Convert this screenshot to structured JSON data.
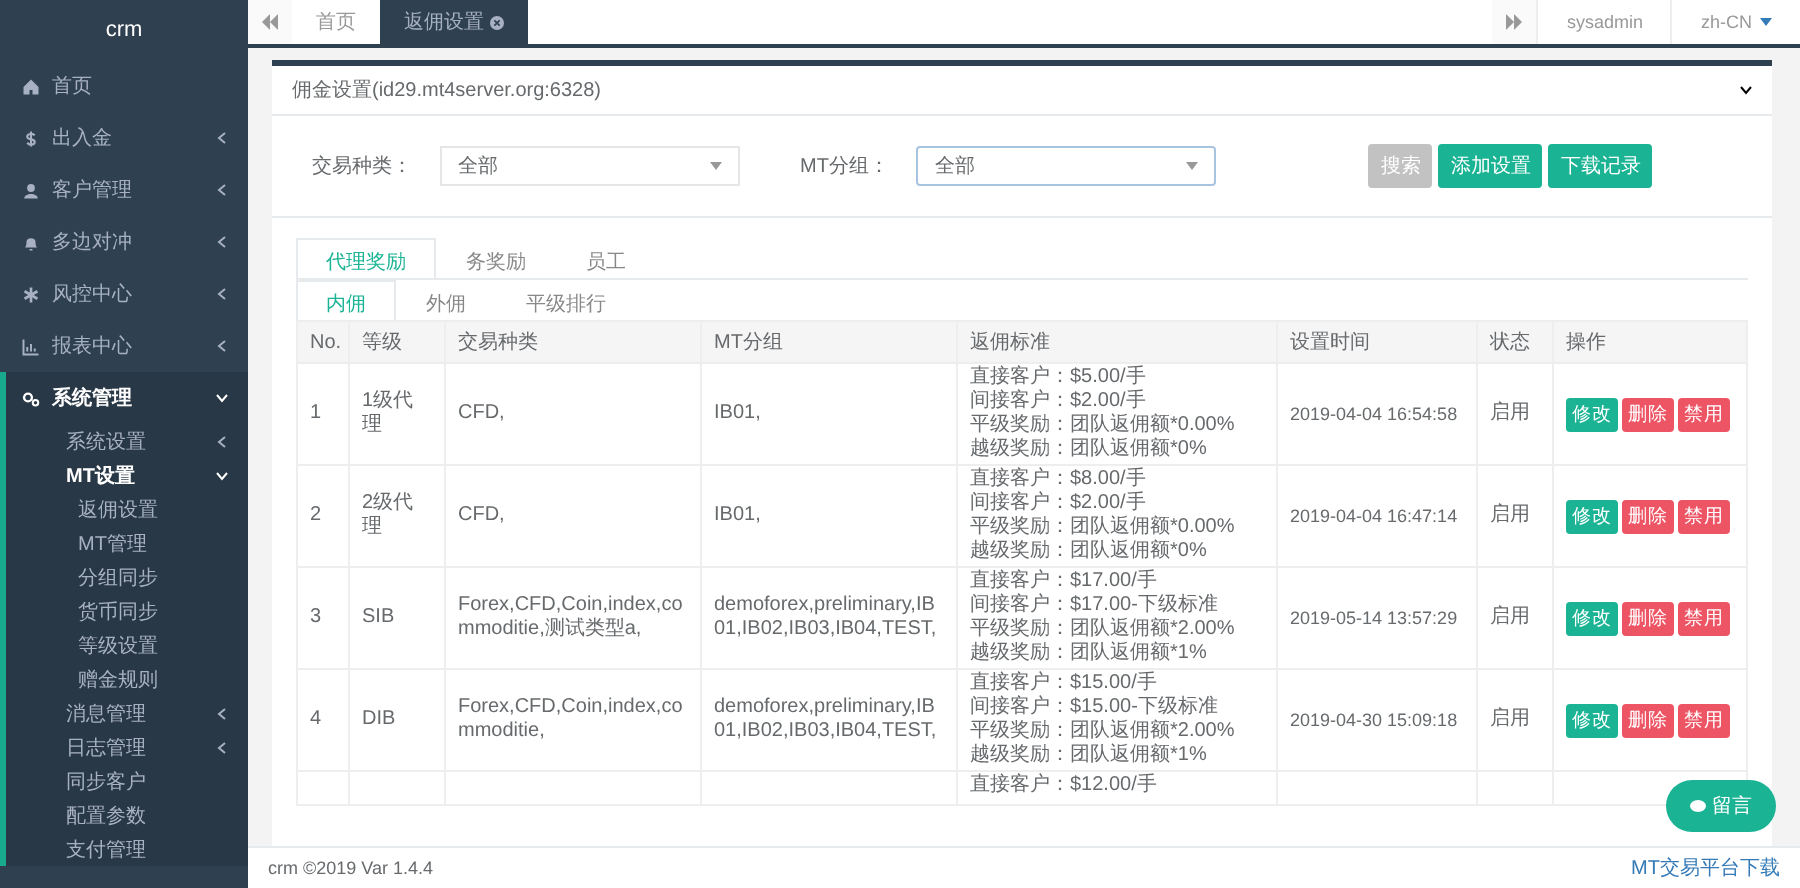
{
  "sidebar": {
    "title": "crm",
    "items": [
      {
        "label": "首页",
        "kind": "link",
        "selected": false
      },
      {
        "label": "出入金",
        "kind": "group",
        "expanded": false,
        "selected": false
      },
      {
        "label": "客户管理",
        "kind": "group",
        "expanded": false,
        "selected": false
      },
      {
        "label": "多边对冲",
        "kind": "group",
        "expanded": false,
        "selected": false
      },
      {
        "label": "风控中心",
        "kind": "group",
        "expanded": false,
        "selected": false
      },
      {
        "label": "报表中心",
        "kind": "group",
        "expanded": false,
        "selected": false
      },
      {
        "label": "系统管理",
        "kind": "group",
        "expanded": true,
        "selected": true,
        "children": [
          {
            "label": "系统设置",
            "kind": "group",
            "expanded": false,
            "selected": false
          },
          {
            "label": "MT设置",
            "kind": "group",
            "expanded": true,
            "selected": true,
            "children": [
              {
                "label": "返佣设置",
                "kind": "link",
                "selected": false
              },
              {
                "label": "MT管理",
                "kind": "link",
                "selected": false
              },
              {
                "label": "分组同步",
                "kind": "link",
                "selected": false
              },
              {
                "label": "货币同步",
                "kind": "link",
                "selected": false
              },
              {
                "label": "等级设置",
                "kind": "link",
                "selected": false
              },
              {
                "label": "赠金规则",
                "kind": "link",
                "selected": false
              }
            ]
          },
          {
            "label": "消息管理",
            "kind": "group",
            "expanded": false,
            "selected": false
          },
          {
            "label": "日志管理",
            "kind": "group",
            "expanded": false,
            "selected": false
          },
          {
            "label": "同步客户",
            "kind": "link",
            "selected": false
          },
          {
            "label": "配置参数",
            "kind": "link",
            "selected": false
          },
          {
            "label": "支付管理",
            "kind": "link",
            "selected": false
          }
        ]
      }
    ]
  },
  "topbar": {
    "tabs": [
      {
        "label": "首页",
        "selected": false,
        "closable": false
      },
      {
        "label": "返佣设置",
        "selected": true,
        "closable": true
      }
    ],
    "user": "sysadmin",
    "language": "zh-CN"
  },
  "panel": {
    "title": "佣金设置(id29.mt4server.org:6328)",
    "filters": [
      {
        "label": "交易种类：",
        "value": "全部",
        "focused": false
      },
      {
        "label": "MT分组：",
        "value": "全部",
        "focused": true
      }
    ],
    "buttons": [
      {
        "label": "搜索",
        "kind": "default"
      },
      {
        "label": "添加设置",
        "kind": "primary"
      },
      {
        "label": "下载记录",
        "kind": "primary"
      }
    ],
    "tabs": [
      {
        "label": "代理奖励",
        "selected": true
      },
      {
        "label": "务奖励",
        "selected": false
      },
      {
        "label": "员工",
        "selected": false
      }
    ],
    "subtabs": [
      {
        "label": "内佣",
        "selected": true
      },
      {
        "label": "外佣",
        "selected": false
      },
      {
        "label": "平级排行",
        "selected": false
      }
    ],
    "table": {
      "columns": [
        "No.",
        "等级",
        "交易种类",
        "MT分组",
        "返佣标准",
        "设置时间",
        "状态",
        "操作"
      ],
      "rows": [
        {
          "no": "1",
          "level": "1级代理",
          "types": "CFD,",
          "groups": "IB01,",
          "standard": [
            "直接客户：$5.00/手",
            "间接客户：$2.00/手",
            "平级奖励：团队返佣额*0.00%",
            "越级奖励：团队返佣额*0%"
          ],
          "time": "2019-04-04 16:54:58",
          "status": "启用",
          "actions": [
            {
              "label": "修改",
              "kind": "primary"
            },
            {
              "label": "删除",
              "kind": "danger"
            },
            {
              "label": "禁用",
              "kind": "danger"
            }
          ]
        },
        {
          "no": "2",
          "level": "2级代理",
          "types": "CFD,",
          "groups": "IB01,",
          "standard": [
            "直接客户：$8.00/手",
            "间接客户：$2.00/手",
            "平级奖励：团队返佣额*0.00%",
            "越级奖励：团队返佣额*0%"
          ],
          "time": "2019-04-04 16:47:14",
          "status": "启用",
          "actions": [
            {
              "label": "修改",
              "kind": "primary"
            },
            {
              "label": "删除",
              "kind": "danger"
            },
            {
              "label": "禁用",
              "kind": "danger"
            }
          ]
        },
        {
          "no": "3",
          "level": "SIB",
          "types": "Forex,CFD,Coin,index,commoditie,测试类型a,",
          "groups": "demoforex,preliminary,IB01,IB02,IB03,IB04,TEST,",
          "standard": [
            "直接客户：$17.00/手",
            "间接客户：$17.00-下级标准",
            "平级奖励：团队返佣额*2.00%",
            "越级奖励：团队返佣额*1%"
          ],
          "time": "2019-05-14 13:57:29",
          "status": "启用",
          "actions": [
            {
              "label": "修改",
              "kind": "primary"
            },
            {
              "label": "删除",
              "kind": "danger"
            },
            {
              "label": "禁用",
              "kind": "danger"
            }
          ]
        },
        {
          "no": "4",
          "level": "DIB",
          "types": "Forex,CFD,Coin,index,commoditie,",
          "groups": "demoforex,preliminary,IB01,IB02,IB03,IB04,TEST,",
          "standard": [
            "直接客户：$15.00/手",
            "间接客户：$15.00-下级标准",
            "平级奖励：团队返佣额*2.00%",
            "越级奖励：团队返佣额*1%"
          ],
          "time": "2019-04-30 15:09:18",
          "status": "启用",
          "actions": [
            {
              "label": "修改",
              "kind": "primary"
            },
            {
              "label": "删除",
              "kind": "danger"
            },
            {
              "label": "禁用",
              "kind": "danger"
            }
          ]
        },
        {
          "standard": [
            "直接客户：$12.00/手"
          ]
        }
      ]
    }
  },
  "chat_button": {
    "label": "留言"
  },
  "footer": {
    "copyright": "crm ©2019 Var 1.4.4",
    "download_link": "MT交易平台下载"
  }
}
